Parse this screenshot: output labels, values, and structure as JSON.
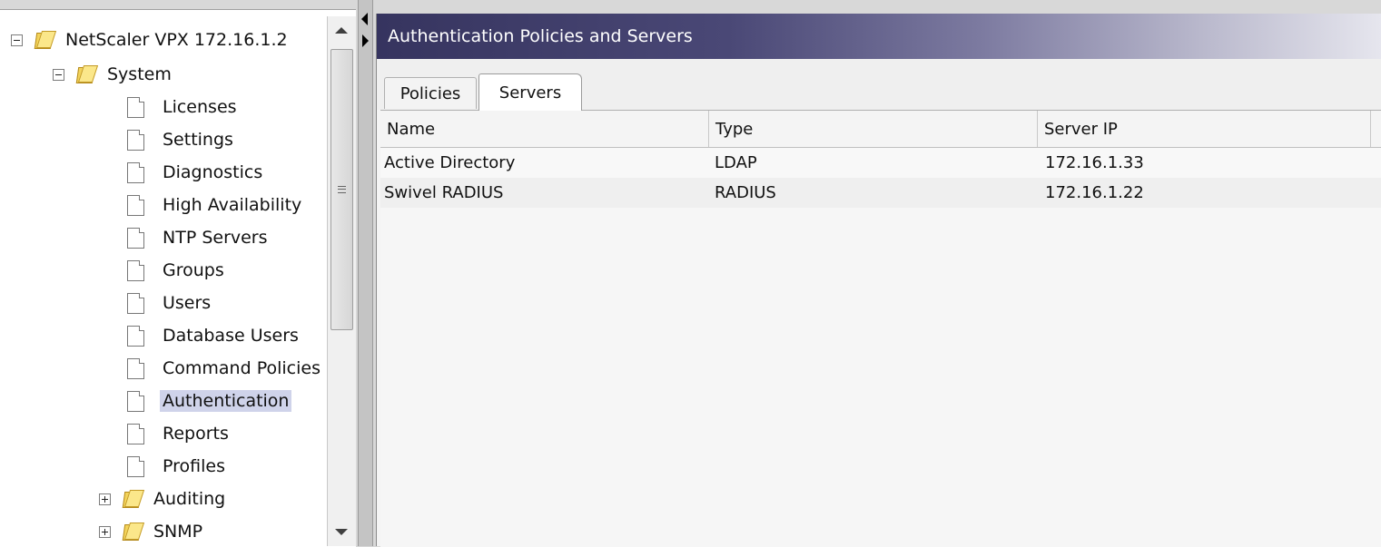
{
  "tree": {
    "root": "NetScaler VPX 172.16.1.2",
    "system": "System",
    "items": [
      "Licenses",
      "Settings",
      "Diagnostics",
      "High Availability",
      "NTP Servers",
      "Groups",
      "Users",
      "Database Users",
      "Command Policies",
      "Authentication",
      "Reports",
      "Profiles"
    ],
    "selected": "Authentication",
    "collapsed_folders": [
      "Auditing",
      "SNMP"
    ]
  },
  "panel": {
    "title": "Authentication Policies and Servers",
    "tabs": [
      "Policies",
      "Servers"
    ],
    "active_tab": "Servers"
  },
  "table": {
    "columns": [
      "Name",
      "Type",
      "Server IP"
    ],
    "rows": [
      [
        "Active Directory",
        "LDAP",
        "172.16.1.33"
      ],
      [
        "Swivel RADIUS",
        "RADIUS",
        "172.16.1.22"
      ]
    ]
  },
  "colors": {
    "header_dark": "#36345f",
    "selection": "#cfd3ea",
    "folder": "#f3d35a"
  }
}
